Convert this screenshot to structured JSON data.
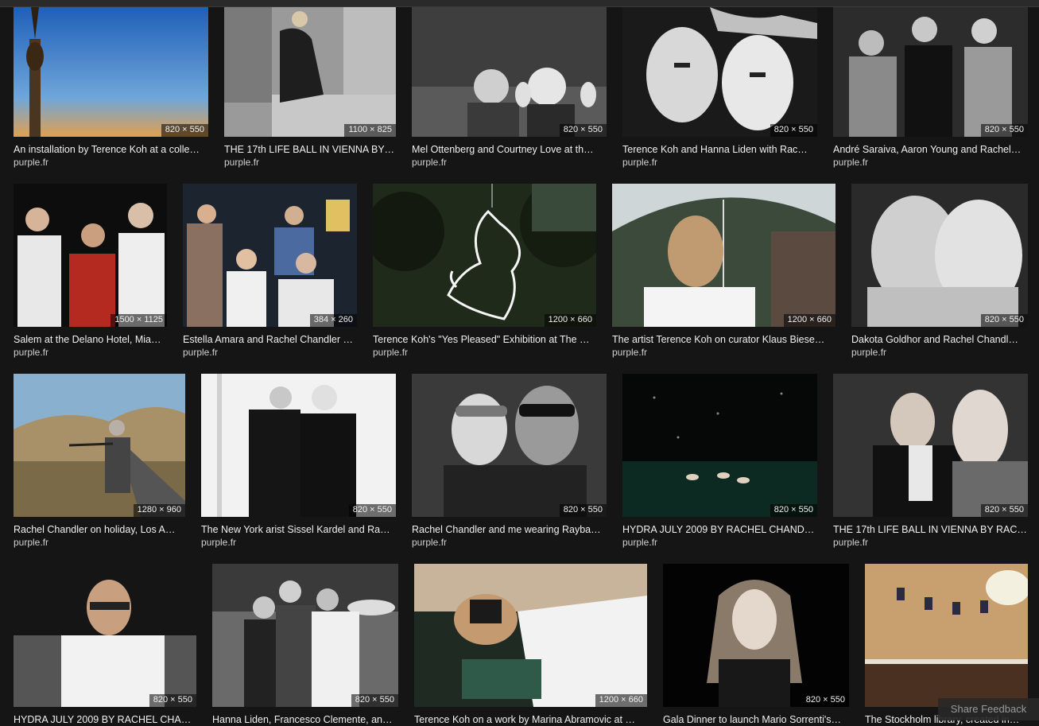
{
  "results": [
    {
      "caption": "An installation by Terence Koh at a colle…",
      "source": "purple.fr",
      "dims": "820 × 550",
      "subject": "wooden-totem-sky-photo"
    },
    {
      "caption": "THE 17th LIFE BALL IN VIENNA BY …",
      "source": "purple.fr",
      "dims": "1100 × 825",
      "subject": "woman-on-steps-photo"
    },
    {
      "caption": "Mel Ottenberg and Courtney Love at th…",
      "source": "purple.fr",
      "dims": "820 × 550",
      "subject": "couple-waving-photo"
    },
    {
      "caption": "Terence Koh and Hanna Liden with Rac…",
      "source": "purple.fr",
      "dims": "820 × 550",
      "subject": "two-faces-closeup-photo"
    },
    {
      "caption": "André Saraiva, Aaron Young and Rachel…",
      "source": "purple.fr",
      "dims": "820 × 550",
      "subject": "three-people-party-photo"
    },
    {
      "caption": "Salem at the Delano Hotel, Mia…",
      "source": "purple.fr",
      "dims": "1500 × 1125",
      "subject": "three-people-night-photo"
    },
    {
      "caption": "Estella Amara and Rachel Chandler …",
      "source": "purple.fr",
      "dims": "384 × 260",
      "subject": "group-party-photo"
    },
    {
      "caption": "Terence Koh's \"Yes Pleased\" Exhibition at The …",
      "source": "purple.fr",
      "dims": "1200 × 660",
      "subject": "neon-sculpture-forest-photo"
    },
    {
      "caption": "The artist Terence Koh on curator Klaus Biese…",
      "source": "purple.fr",
      "dims": "1200 × 660",
      "subject": "man-under-umbrella-photo"
    },
    {
      "caption": "Dakota Goldhor and Rachel Chandl…",
      "source": "purple.fr",
      "dims": "820 × 550",
      "subject": "two-women-cheek-photo"
    },
    {
      "caption": "Rachel Chandler on holiday, Los A…",
      "source": "purple.fr",
      "dims": "1280 × 960",
      "subject": "woman-with-rifle-landscape-photo"
    },
    {
      "caption": "The New York arist Sissel Kardel and Ra…",
      "source": "purple.fr",
      "dims": "820 × 550",
      "subject": "two-women-posing-photo"
    },
    {
      "caption": "Rachel Chandler and me wearing Rayba…",
      "source": "purple.fr",
      "dims": "820 × 550",
      "subject": "couple-sunglasses-photo"
    },
    {
      "caption": "HYDRA JULY 2009 BY RACHEL CHAND…",
      "source": "purple.fr",
      "dims": "820 × 550",
      "subject": "night-swimmers-photo"
    },
    {
      "caption": "THE 17th LIFE BALL IN VIENNA BY RAC…",
      "source": "purple.fr",
      "dims": "820 × 550",
      "subject": "man-in-suit-photo"
    },
    {
      "caption": "HYDRA JULY 2009 BY RACHEL CHA…",
      "source": "purple.fr",
      "dims": "820 × 550",
      "subject": "man-with-glasses-photo"
    },
    {
      "caption": "Hanna Liden, Francesco Clemente, an…",
      "source": "purple.fr",
      "dims": "820 × 550",
      "subject": "three-people-street-photo"
    },
    {
      "caption": "Terence Koh on a work by Marina Abramovic at …",
      "source": "purple.fr",
      "dims": "1200 × 660",
      "subject": "man-lying-down-photo"
    },
    {
      "caption": "Gala Dinner to launch Mario Sorrenti's…",
      "source": "purple.fr",
      "dims": "820 × 550",
      "subject": "woman-portrait-dark-photo"
    },
    {
      "caption": "The Stockholm library, created in…",
      "source": "purple.fr",
      "dims": "",
      "subject": "library-rotunda-photo"
    }
  ],
  "feedback_label": "Share Feedback"
}
